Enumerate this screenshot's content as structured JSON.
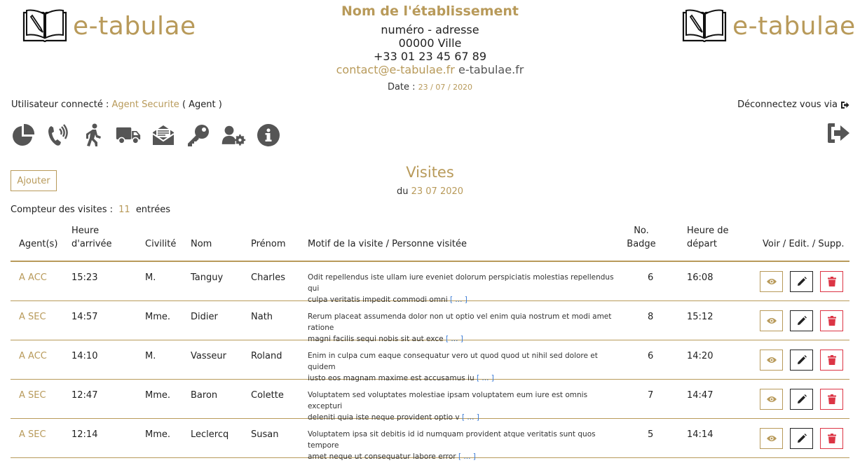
{
  "brand": {
    "name": "e-tabulae"
  },
  "establishment": {
    "name": "Nom de l'établissement",
    "address": "numéro - adresse",
    "city": "00000 Ville",
    "phone": "+33 01 23 45 67 89",
    "email": "contact@e-tabulae.fr",
    "website": "e-tabulae.fr",
    "date_label": "Date :",
    "date_value": "23 / 07 / 2020"
  },
  "user": {
    "prefix": "Utilisateur connecté :",
    "name": "Agent Securite",
    "role": "( Agent )",
    "logout_text": "Déconnectez vous via"
  },
  "toolbar": {
    "icons": [
      "chart-pie-icon",
      "phone-volume-icon",
      "walking-icon",
      "truck-icon",
      "mail-bulk-icon",
      "key-icon",
      "users-cog-icon",
      "info-circle-icon"
    ]
  },
  "page": {
    "add_label": "Ajouter",
    "title": "Visites",
    "subtitle_prefix": "du",
    "subtitle_date": "23 07 2020",
    "counter_prefix": "Compteur des visites :",
    "counter_value": "11",
    "counter_suffix": "entrées"
  },
  "table": {
    "headers": {
      "agent": "Agent(s)",
      "arrival_1": "Heure",
      "arrival_2": "d'arrivée",
      "civility": "Civilité",
      "lastname": "Nom",
      "firstname": "Prénom",
      "motif": "Motif de la visite / Personne visitée",
      "badge_1": "No.",
      "badge_2": "Badge",
      "departure_1": "Heure de",
      "departure_2": "départ",
      "actions": "Voir / Edit. / Supp."
    },
    "more_label": "[ ... ]",
    "rows": [
      {
        "agent": "A ACC",
        "arrival": "15:23",
        "civility": "M.",
        "lastname": "Tanguy",
        "firstname": "Charles",
        "motif_1": "Odit repellendus iste ullam iure eveniet dolorum perspiciatis molestias repellendus qui",
        "motif_2": "culpa veritatis impedit commodi omni",
        "badge": "6",
        "departure": "16:08"
      },
      {
        "agent": "A SEC",
        "arrival": "14:57",
        "civility": "Mme.",
        "lastname": "Didier",
        "firstname": "Nath",
        "motif_1": "Rerum placeat assumenda dolor non ut optio vel enim quia nostrum et modi amet ratione",
        "motif_2": "magni facilis sequi nobis sit aut exce",
        "badge": "8",
        "departure": "15:12"
      },
      {
        "agent": "A ACC",
        "arrival": "14:10",
        "civility": "M.",
        "lastname": "Vasseur",
        "firstname": "Roland",
        "motif_1": "Enim in culpa cum eaque consequatur vero ut quod quod ut nihil sed dolore et quidem",
        "motif_2": "iusto eos magnam maxime est accusamus iu",
        "badge": "6",
        "departure": "14:20"
      },
      {
        "agent": "A SEC",
        "arrival": "12:47",
        "civility": "Mme.",
        "lastname": "Baron",
        "firstname": "Colette",
        "motif_1": "Voluptatem sed voluptates molestiae ipsam voluptatem eum iure est omnis excepturi",
        "motif_2": "deleniti quia iste neque provident optio v",
        "badge": "7",
        "departure": "14:47"
      },
      {
        "agent": "A SEC",
        "arrival": "12:14",
        "civility": "Mme.",
        "lastname": "Leclercq",
        "firstname": "Susan",
        "motif_1": "Voluptatem ipsa sit debitis id id numquam provident atque veritatis sunt quos tempore",
        "motif_2": "amet neque ut consequatur labore error",
        "badge": "5",
        "departure": "14:14"
      }
    ]
  }
}
